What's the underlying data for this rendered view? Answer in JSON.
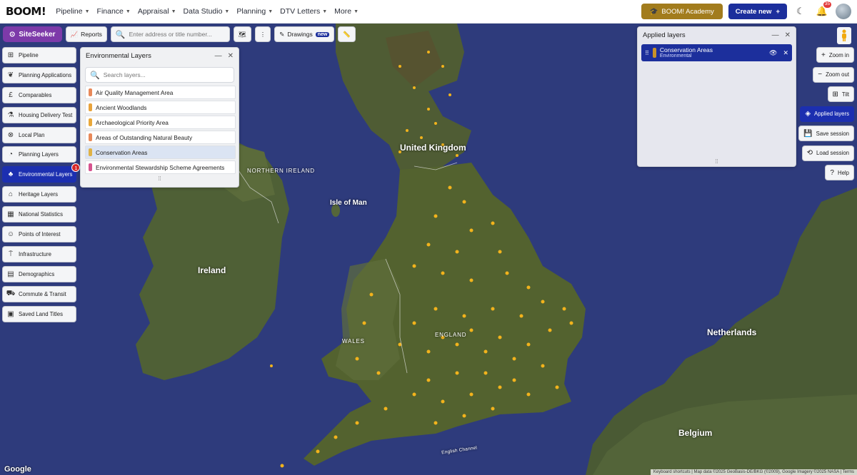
{
  "nav": {
    "logo": "BOOM!",
    "items": [
      {
        "label": "Pipeline"
      },
      {
        "label": "Finance"
      },
      {
        "label": "Appraisal"
      },
      {
        "label": "Data Studio"
      },
      {
        "label": "Planning"
      },
      {
        "label": "DTV Letters"
      },
      {
        "label": "More"
      }
    ],
    "academy_label": "BOOM! Academy",
    "create_label": "Create new",
    "notification_count": "35"
  },
  "toolbar": {
    "siteseeker_label": "SiteSeeker",
    "reports_label": "Reports",
    "search_placeholder": "Enter address or title number...",
    "drawings_label": "Drawings",
    "new_badge": "new"
  },
  "sidebar": {
    "items": [
      {
        "label": "Pipeline",
        "icon": "pipeline-icon"
      },
      {
        "label": "Planning Applications",
        "icon": "leaf-icon"
      },
      {
        "label": "Comparables",
        "icon": "pound-icon"
      },
      {
        "label": "Housing Delivery Test",
        "icon": "flask-icon"
      },
      {
        "label": "Local Plan",
        "icon": "compass-icon"
      },
      {
        "label": "Planning Layers",
        "icon": "gauge-icon"
      },
      {
        "label": "Environmental Layers",
        "icon": "tree-icon",
        "active": true,
        "badge": "1"
      },
      {
        "label": "Heritage Layers",
        "icon": "building-icon"
      },
      {
        "label": "National Statistics",
        "icon": "stats-icon"
      },
      {
        "label": "Points of Interest",
        "icon": "person-icon"
      },
      {
        "label": "Infrastructure",
        "icon": "pylon-icon"
      },
      {
        "label": "Demographics",
        "icon": "chart-icon"
      },
      {
        "label": "Commute & Transit",
        "icon": "car-icon"
      },
      {
        "label": "Saved Land Titles",
        "icon": "document-icon"
      }
    ]
  },
  "env_panel": {
    "title": "Environmental Layers",
    "search_placeholder": "Search layers...",
    "layers": [
      {
        "label": "Air Quality Management Area",
        "color": "#e8895a"
      },
      {
        "label": "Ancient Woodlands",
        "color": "#e8a33c"
      },
      {
        "label": "Archaeological Priority Area",
        "color": "#e9a83a"
      },
      {
        "label": "Areas of Outstanding Natural Beauty",
        "color": "#e8895a"
      },
      {
        "label": "Conservation Areas",
        "color": "#e0b245",
        "selected": true
      },
      {
        "label": "Environmental Stewardship Scheme Agreements",
        "color": "#d6538f"
      }
    ]
  },
  "applied_panel": {
    "title": "Applied layers",
    "items": [
      {
        "name": "Conservation Areas",
        "category": "Environmental",
        "color": "#c8922a"
      }
    ]
  },
  "right_controls": {
    "zoom_in": "Zoom in",
    "zoom_out": "Zoom out",
    "tilt": "Tilt",
    "applied_layers": "Applied layers",
    "save_session": "Save session",
    "load_session": "Load session",
    "help": "Help"
  },
  "map": {
    "labels": {
      "united_kingdom": "United Kingdom",
      "northern_ireland": "NORTHERN IRELAND",
      "isle_of_man": "Isle of Man",
      "ireland": "Ireland",
      "wales": "WALES",
      "england": "ENGLAND",
      "netherlands": "Netherlands",
      "belgium": "Belgium",
      "english_channel": "English Channel"
    },
    "google": "Google",
    "attribution": "Keyboard shortcuts  |  Map data ©2025 GeoBasis-DE/BKG (©2009), Google Imagery ©2025 NASA  |  Terms"
  },
  "colors": {
    "accent": "#1c2fb0",
    "siteseeker": "#7d3aa9",
    "academy": "#a27c1d",
    "markers": "#f2b31c"
  }
}
